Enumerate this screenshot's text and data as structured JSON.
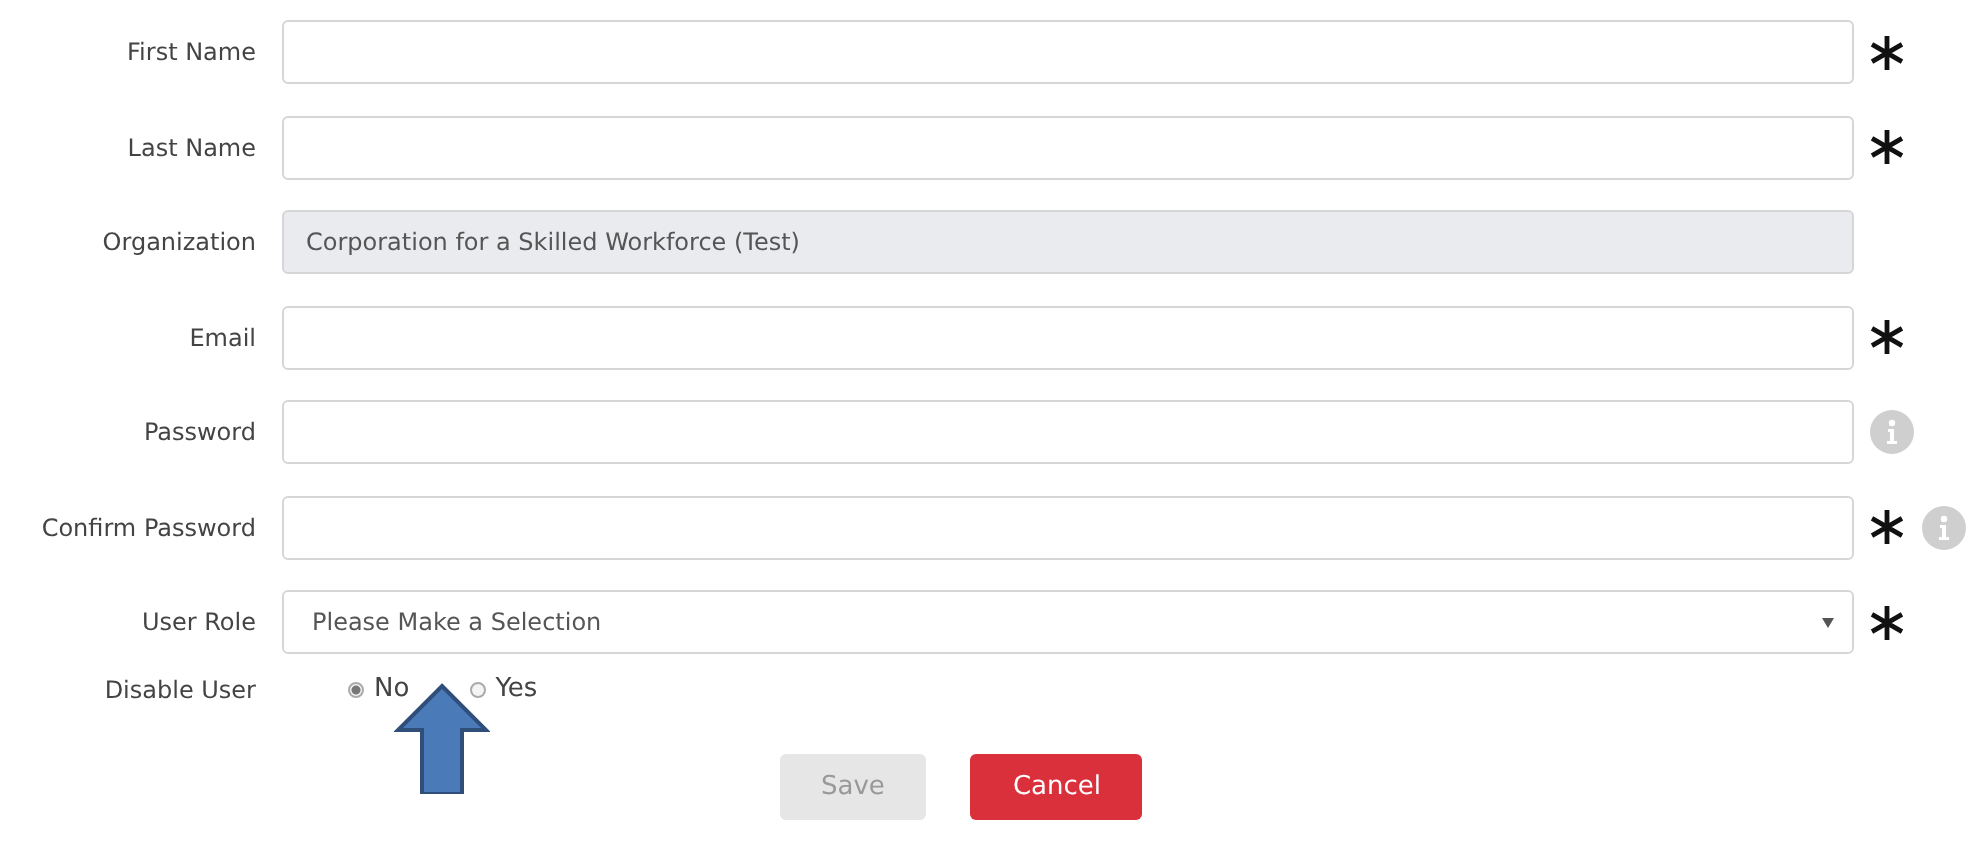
{
  "fields": [
    {
      "label": "First Name",
      "kind": "text",
      "required": true,
      "info": false
    },
    {
      "label": "Last Name",
      "kind": "text",
      "required": true,
      "info": false
    },
    {
      "label": "Organization",
      "kind": "readonly",
      "value": "Corporation for a Skilled Workforce (Test)",
      "required": false,
      "info": false
    },
    {
      "label": "Email",
      "kind": "text",
      "required": true,
      "info": false
    },
    {
      "label": "Password",
      "kind": "text",
      "required": false,
      "info": true
    },
    {
      "label": "Confirm Password",
      "kind": "text",
      "required": true,
      "info": true
    },
    {
      "label": "User Role",
      "kind": "select",
      "value": "Please Make a Selection",
      "required": true,
      "info": false
    }
  ],
  "disable_user": {
    "label": "Disable User",
    "options": [
      {
        "label": "No",
        "selected": true
      },
      {
        "label": "Yes",
        "selected": false
      }
    ]
  },
  "buttons": [
    {
      "label": "Save",
      "kind": "secondary"
    },
    {
      "label": "Cancel",
      "kind": "danger"
    }
  ]
}
